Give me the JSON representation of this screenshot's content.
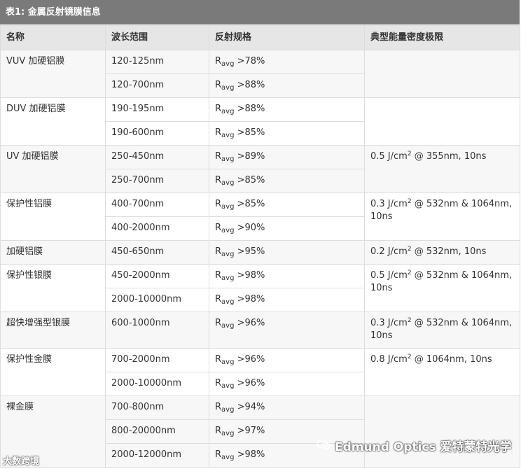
{
  "table_title": "表1: 金属反射镜膜信息",
  "headers": [
    "名称",
    "波长范围",
    "反射规格",
    "典型能量密度极限"
  ],
  "rows": [
    {
      "name": "VUV 加硬铝膜",
      "wl": "120-125nm",
      "r": ">78%",
      "lidt": "",
      "lidt_unit": "",
      "lidt_rest": ""
    },
    {
      "name": "",
      "wl": "120-700nm",
      "r": ">88%"
    },
    {
      "name": "DUV 加硬铝膜",
      "wl": "190-195nm",
      "r": ">88%",
      "lidt": "",
      "lidt_unit": "",
      "lidt_rest": ""
    },
    {
      "name": "",
      "wl": "190-600nm",
      "r": ">85%"
    },
    {
      "name": "UV 加硬铝膜",
      "wl": "250-450nm",
      "r": ">89%",
      "lidt": "0.5 J/cm",
      "lidt_unit": "2",
      "lidt_rest": " @ 355nm, 10ns"
    },
    {
      "name": "",
      "wl": "250-700nm",
      "r": ">85%"
    },
    {
      "name": "保护性铝膜",
      "wl": "400-700nm",
      "r": ">85%",
      "lidt": "0.3 J/cm",
      "lidt_unit": "2",
      "lidt_rest": " @ 532nm & 1064nm, 10ns"
    },
    {
      "name": "",
      "wl": "400-2000nm",
      "r": ">90%"
    },
    {
      "name": "加硬铝膜",
      "wl": "450-650nm",
      "r": ">95%",
      "lidt": "0.2 J/cm",
      "lidt_unit": "2",
      "lidt_rest": " @ 532nm, 10ns"
    },
    {
      "name": "保护性银膜",
      "wl": "450-2000nm",
      "r": ">98%",
      "lidt": "0.5 J/cm",
      "lidt_unit": "2",
      "lidt_rest": " @ 532nm & 1064nm, 10ns"
    },
    {
      "name": "",
      "wl": "2000-10000nm",
      "r": ">98%"
    },
    {
      "name": "超快增强型银膜",
      "wl": "600-1000nm",
      "r": ">96%",
      "lidt": "0.3 J/cm",
      "lidt_unit": "2",
      "lidt_rest": " @ 532nm & 1064nm, 10ns"
    },
    {
      "name": "保护性金膜",
      "wl": "700-2000nm",
      "r": ">96%",
      "lidt": "0.8 J/cm",
      "lidt_unit": "2",
      "lidt_rest": " @ 1064nm, 10ns"
    },
    {
      "name": "",
      "wl": "2000-10000nm",
      "r": ">96%"
    },
    {
      "name": "裸金膜",
      "wl": "700-800nm",
      "r": ">94%",
      "lidt": "",
      "lidt_unit": "",
      "lidt_rest": ""
    },
    {
      "name": "",
      "wl": "800-20000nm",
      "r": ">97%"
    },
    {
      "name": "",
      "wl": "2000-12000nm",
      "r": ">98%"
    }
  ],
  "r_symbol": "R",
  "r_sub": "avg",
  "watermark_left": "大数跨境",
  "watermark_right": "Edmund Optics 爱特蒙特光学",
  "watermark_right_icon": "wechat-icon"
}
